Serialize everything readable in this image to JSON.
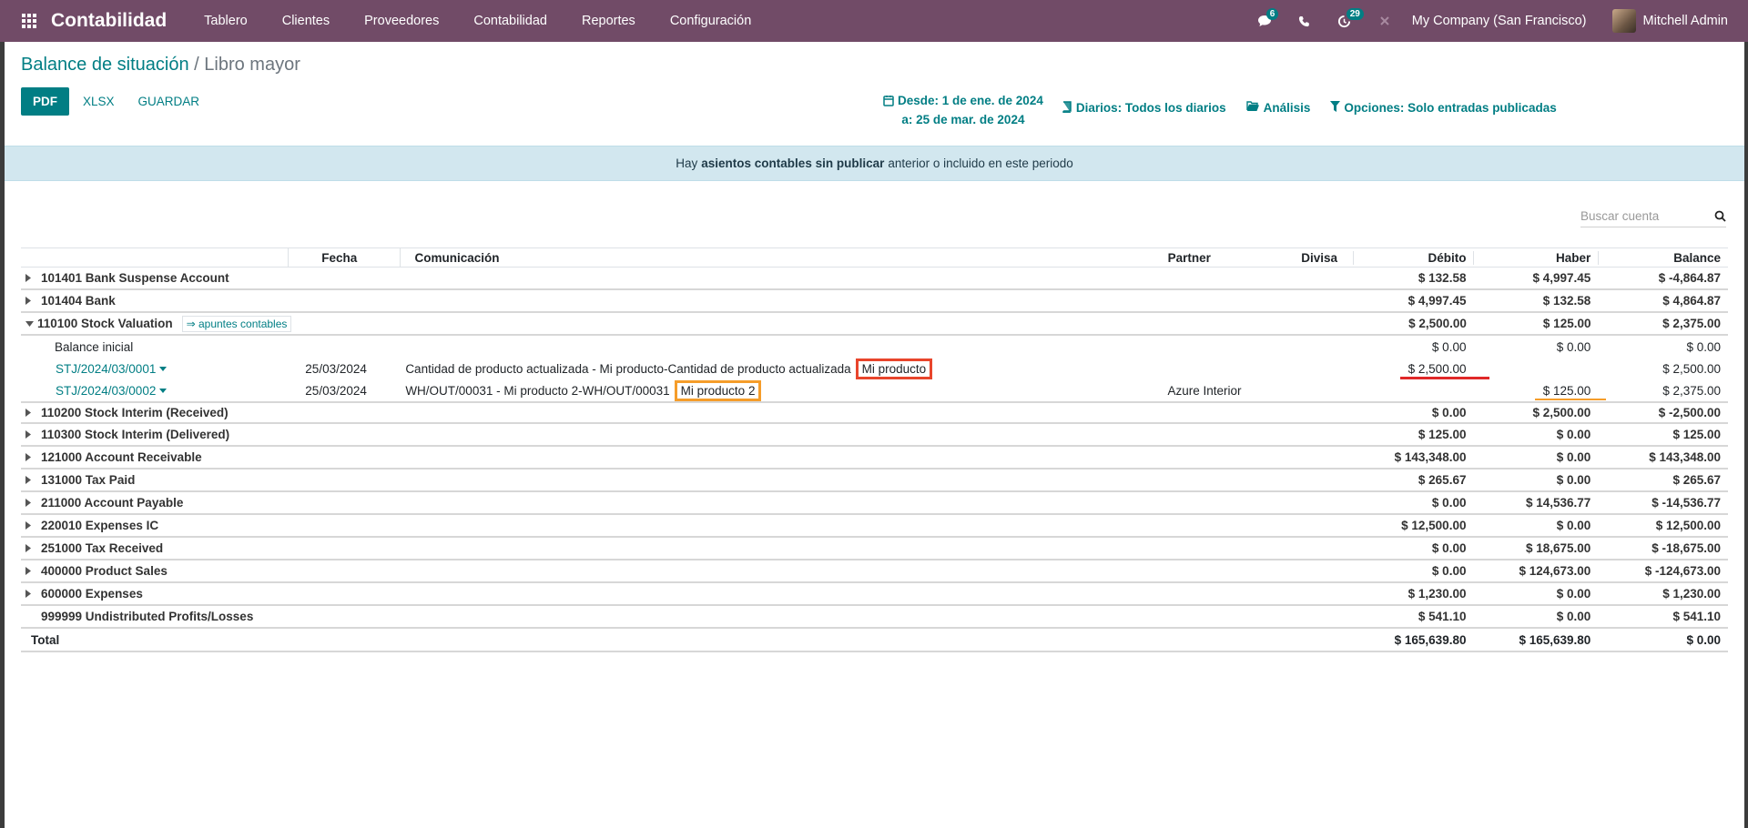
{
  "navbar": {
    "app_name": "Contabilidad",
    "menu": [
      "Tablero",
      "Clientes",
      "Proveedores",
      "Contabilidad",
      "Reportes",
      "Configuración"
    ],
    "messages_count": "6",
    "activities_count": "29",
    "company": "My Company (San Francisco)",
    "user": "Mitchell Admin"
  },
  "breadcrumb": {
    "parent": "Balance de situación",
    "separator": "/",
    "current": "Libro mayor"
  },
  "buttons": {
    "pdf": "PDF",
    "xlsx": "XLSX",
    "save": "GUARDAR"
  },
  "filters": {
    "date_from": "Desde: 1 de ene. de 2024",
    "date_to": "a: 25 de mar. de 2024",
    "journals": "Diarios: Todos los diarios",
    "analysis": "Análisis",
    "options": "Opciones: Solo entradas publicadas"
  },
  "alert": {
    "prefix": "Hay",
    "bold": "asientos contables sin publicar",
    "suffix": "anterior o incluido en este periodo"
  },
  "search": {
    "placeholder": "Buscar cuenta"
  },
  "table": {
    "headers": {
      "fecha": "Fecha",
      "comunicacion": "Comunicación",
      "partner": "Partner",
      "divisa": "Divisa",
      "debito": "Débito",
      "haber": "Haber",
      "balance": "Balance"
    },
    "accounts": [
      {
        "name": "101401 Bank Suspense Account",
        "debit": "$ 132.58",
        "credit": "$ 4,997.45",
        "balance": "$ -4,864.87"
      },
      {
        "name": "101404 Bank",
        "debit": "$ 4,997.45",
        "credit": "$ 132.58",
        "balance": "$ 4,864.87"
      },
      {
        "name": "110100 Stock Valuation",
        "link": "⇒ apuntes contables",
        "debit": "$ 2,500.00",
        "credit": "$ 125.00",
        "balance": "$ 2,375.00"
      },
      {
        "name": "110200 Stock Interim (Received)",
        "debit": "$ 0.00",
        "credit": "$ 2,500.00",
        "balance": "$ -2,500.00"
      },
      {
        "name": "110300 Stock Interim (Delivered)",
        "debit": "$ 125.00",
        "credit": "$ 0.00",
        "balance": "$ 125.00"
      },
      {
        "name": "121000 Account Receivable",
        "debit": "$ 143,348.00",
        "credit": "$ 0.00",
        "balance": "$ 143,348.00"
      },
      {
        "name": "131000 Tax Paid",
        "debit": "$ 265.67",
        "credit": "$ 0.00",
        "balance": "$ 265.67"
      },
      {
        "name": "211000 Account Payable",
        "debit": "$ 0.00",
        "credit": "$ 14,536.77",
        "balance": "$ -14,536.77"
      },
      {
        "name": "220010 Expenses IC",
        "debit": "$ 12,500.00",
        "credit": "$ 0.00",
        "balance": "$ 12,500.00"
      },
      {
        "name": "251000 Tax Received",
        "debit": "$ 0.00",
        "credit": "$ 18,675.00",
        "balance": "$ -18,675.00"
      },
      {
        "name": "400000 Product Sales",
        "debit": "$ 0.00",
        "credit": "$ 124,673.00",
        "balance": "$ -124,673.00"
      },
      {
        "name": "600000 Expenses",
        "debit": "$ 1,230.00",
        "credit": "$ 0.00",
        "balance": "$ 1,230.00"
      },
      {
        "name": "999999 Undistributed Profits/Losses",
        "debit": "$ 541.10",
        "credit": "$ 0.00",
        "balance": "$ 541.10"
      }
    ],
    "initial_balance": {
      "label": "Balance inicial",
      "debit": "$ 0.00",
      "credit": "$ 0.00",
      "balance": "$ 0.00"
    },
    "lines": [
      {
        "move": "STJ/2024/03/0001",
        "date": "25/03/2024",
        "communication": "Cantidad de producto actualizada - Mi producto-Cantidad de producto actualizada",
        "highlight": "Mi producto",
        "partner": "",
        "debit": "$ 2,500.00",
        "credit": "",
        "balance": "$ 2,500.00"
      },
      {
        "move": "STJ/2024/03/0002",
        "date": "25/03/2024",
        "communication": "WH/OUT/00031 - Mi producto 2-WH/OUT/00031",
        "highlight": "Mi producto 2",
        "partner": "Azure Interior",
        "debit": "",
        "credit": "$ 125.00",
        "balance": "$ 2,375.00"
      }
    ],
    "total": {
      "label": "Total",
      "debit": "$ 165,639.80",
      "credit": "$ 165,639.80",
      "balance": "$ 0.00"
    }
  },
  "colors": {
    "navbar": "#714b67",
    "accent": "#017e84",
    "alert_bg": "#d2e7ef",
    "highlight_red": "#e8452c",
    "highlight_orange": "#f59d2a"
  }
}
